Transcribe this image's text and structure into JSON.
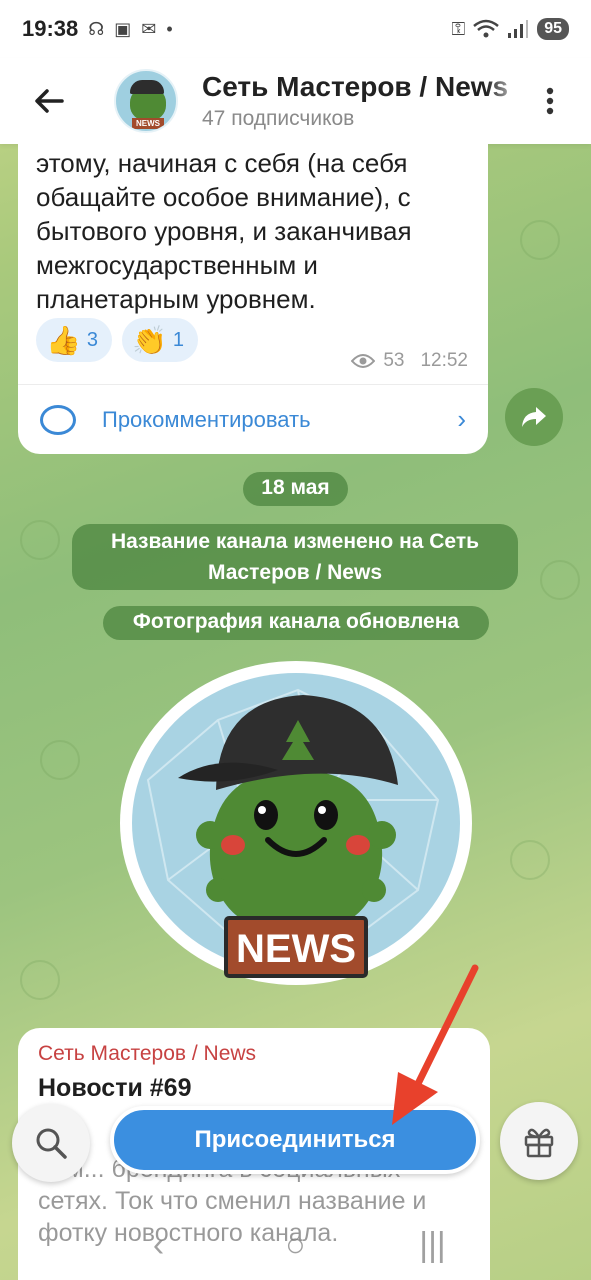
{
  "status_bar": {
    "time": "19:38",
    "icons_left": [
      "app-icon",
      "scan-icon",
      "mail-icon",
      "dot"
    ],
    "icons_right": [
      "key-icon",
      "wifi-icon",
      "signal-icon"
    ],
    "battery": "95"
  },
  "header": {
    "back_icon": "back-arrow-icon",
    "channel_name": "Сеть Мастеров / News",
    "subscribers": "47 подписчиков",
    "menu_icon": "more-vertical-icon"
  },
  "message_top": {
    "text": "этому, начиная с себя (на себя обащайте особое внимание), с бытового уровня, и заканчивая межгосударственным и планетарным уровнем.",
    "reactions": [
      {
        "emoji": "👍",
        "count": "3"
      },
      {
        "emoji": "👏",
        "count": "1"
      }
    ],
    "views": "53",
    "time": "12:52",
    "comment_label": "Прокомментировать"
  },
  "service": {
    "date": "18 мая",
    "renamed": "Название канала изменено на Сеть Мастеров / News",
    "photo_updated": "Фотография канала обновлена"
  },
  "channel_photo": {
    "badge_text": "NEWS"
  },
  "message_bottom": {
    "sender": "Сеть Мастеров / News",
    "title": "Новости #69",
    "body": "Ким... брендинга в социальных сетях. Ток что сменил название и фотку новостного канала."
  },
  "bottom_bar": {
    "join_label": "Присоединиться"
  },
  "colors": {
    "accent": "#3b8fe0",
    "pill": "#558c46",
    "sender": "#c74242",
    "arrow": "#e8412c"
  }
}
